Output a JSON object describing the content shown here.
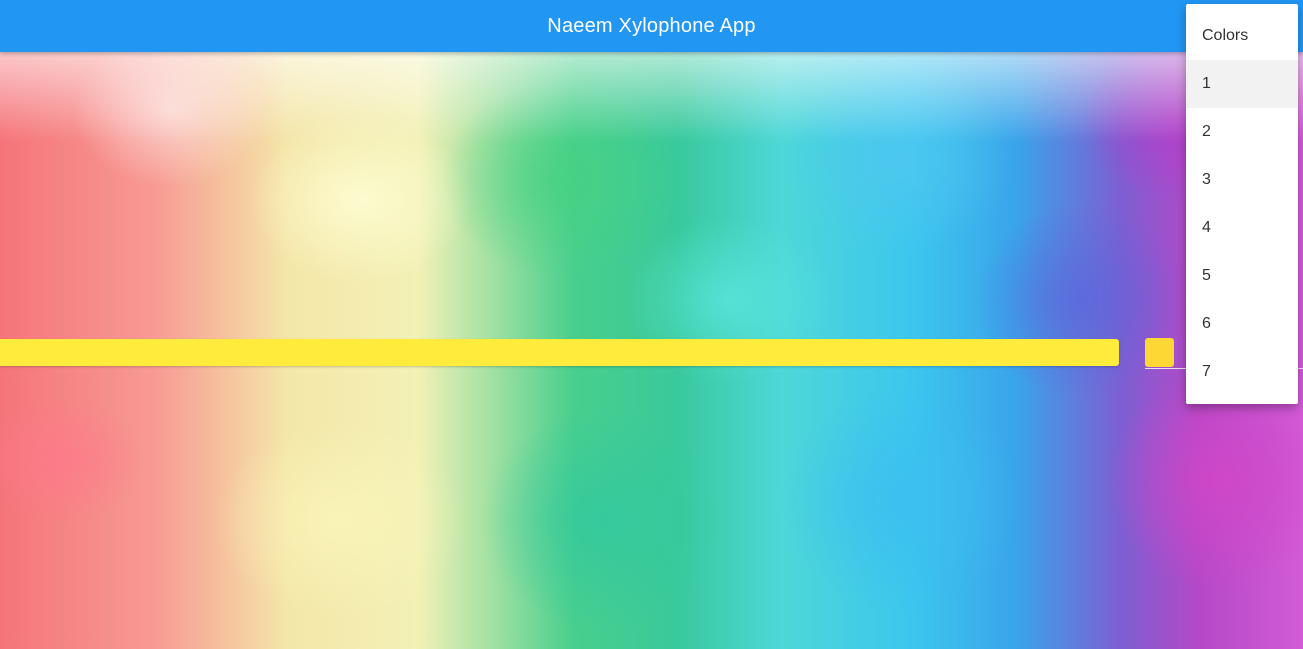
{
  "app": {
    "title": "Naeem Xylophone App"
  },
  "colors": {
    "appbar": "#2196f3",
    "bar": "#ffeb3b",
    "swatch": "#fdd835"
  },
  "menu": {
    "header": "Colors",
    "items": [
      {
        "label": "1",
        "selected": true
      },
      {
        "label": "2"
      },
      {
        "label": "3"
      },
      {
        "label": "4"
      },
      {
        "label": "5"
      },
      {
        "label": "6"
      },
      {
        "label": "7"
      }
    ]
  }
}
